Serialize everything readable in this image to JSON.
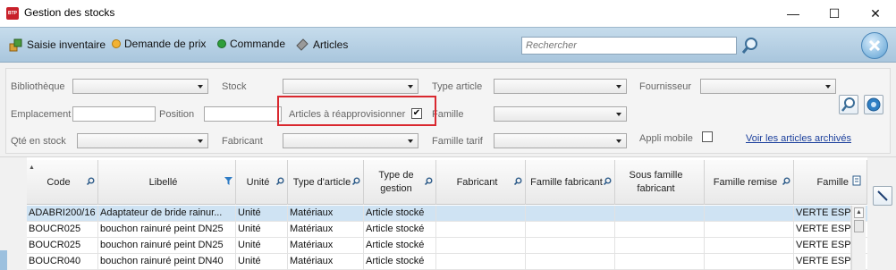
{
  "window": {
    "title": "Gestion des stocks",
    "logo_text": "BTP",
    "controls": {
      "minimize": "—",
      "maximize": "☐",
      "close": "✕"
    }
  },
  "toolbar": {
    "items": [
      {
        "label": "Saisie inventaire",
        "icon": "inventory-icon"
      },
      {
        "label": "Demande de prix",
        "icon": "status-dot-orange",
        "color": "#f2b233"
      },
      {
        "label": "Commande",
        "icon": "status-dot-green",
        "color": "#2e9e3a"
      },
      {
        "label": "Articles",
        "icon": "articles-icon"
      }
    ],
    "search": {
      "placeholder": "Rechercher",
      "value": ""
    }
  },
  "filters": {
    "bibliotheque": {
      "label": "Bibliothèque",
      "value": ""
    },
    "stock": {
      "label": "Stock",
      "value": ""
    },
    "type_article": {
      "label": "Type article",
      "value": ""
    },
    "fournisseur": {
      "label": "Fournisseur",
      "value": ""
    },
    "emplacement": {
      "label": "Emplacement",
      "value": ""
    },
    "position": {
      "label": "Position",
      "value": ""
    },
    "articles_reappro": {
      "label": "Articles à réapprovisionner",
      "checked": true,
      "mark": "✔"
    },
    "famille": {
      "label": "Famille",
      "value": ""
    },
    "qte_stock": {
      "label": "Qté en stock",
      "value": ""
    },
    "fabricant": {
      "label": "Fabricant",
      "value": ""
    },
    "famille_tarif": {
      "label": "Famille tarif",
      "value": ""
    },
    "appli_mobile": {
      "label": "Appli mobile",
      "checked": false
    },
    "archive_link": "Voir les articles archivés"
  },
  "grid": {
    "columns": [
      {
        "label": "Code",
        "icon": "search-icon"
      },
      {
        "label": "Libellé",
        "icon": "filter-icon"
      },
      {
        "label": "Unité",
        "icon": "search-icon"
      },
      {
        "label": "Type d'article",
        "icon": "search-icon"
      },
      {
        "label": "Type de gestion",
        "icon": "search-icon"
      },
      {
        "label": "Fabricant",
        "icon": "search-icon"
      },
      {
        "label": "Famille fabricant",
        "icon": "search-icon"
      },
      {
        "label": "Sous famille fabricant",
        "icon": "search-icon"
      },
      {
        "label": "Famille remise",
        "icon": "search-icon"
      },
      {
        "label": "Famille",
        "icon": ""
      }
    ],
    "rows": [
      [
        "ADABRI200/16",
        "Adaptateur de bride rainur...",
        "Unité",
        "Matériaux",
        "Article stocké",
        "",
        "",
        "",
        "",
        "VERTE ESPAG"
      ],
      [
        "BOUCR025",
        "bouchon rainuré peint DN25",
        "Unité",
        "Matériaux",
        "Article stocké",
        "",
        "",
        "",
        "",
        "VERTE ESPAG"
      ],
      [
        "BOUCR025",
        "bouchon rainuré peint DN25",
        "Unité",
        "Matériaux",
        "Article stocké",
        "",
        "",
        "",
        "",
        "VERTE ESPAG"
      ],
      [
        "BOUCR040",
        "bouchon rainuré peint DN40",
        "Unité",
        "Matériaux",
        "Article stocké",
        "",
        "",
        "",
        "",
        "VERTE ESPAG"
      ]
    ],
    "selected_row": 0
  },
  "colors": {
    "accent": "#a9c6dd",
    "highlight": "#d9282f",
    "link": "#1b3f9c",
    "selection": "#cfe3f3"
  }
}
